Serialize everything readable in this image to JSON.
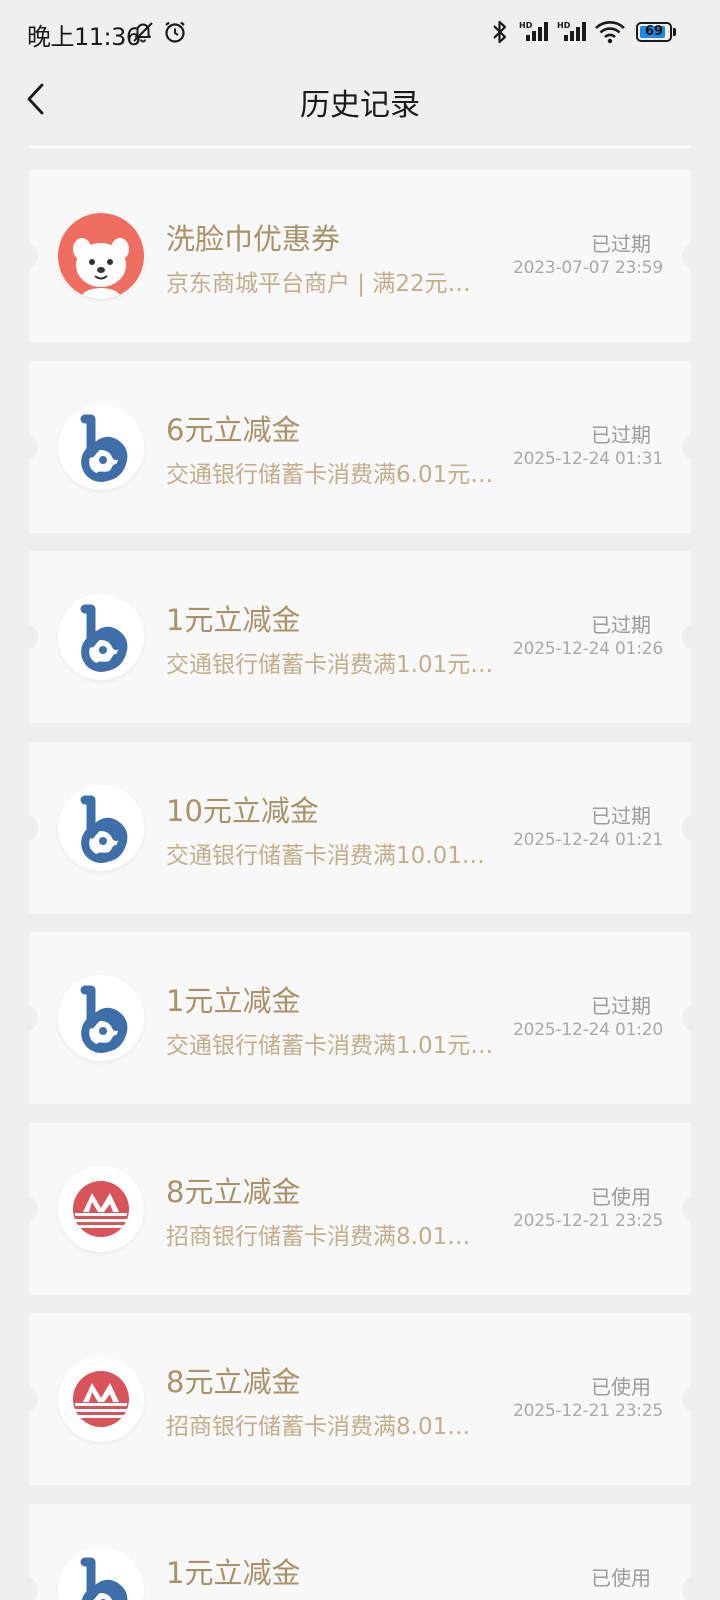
{
  "status_bar": {
    "time": "晚上11:36",
    "icons": [
      "mute-bell-icon",
      "alarm-icon",
      "bluetooth-icon",
      "signal-hd-icon",
      "signal-hd-icon",
      "wifi-icon"
    ],
    "battery": "69",
    "battery_color": "#1e88e5"
  },
  "header": {
    "title": "历史记录",
    "back_icon": "chevron-left-icon"
  },
  "records": [
    {
      "logo": "jd-mascot",
      "title": "洗脸巾优惠券",
      "desc": "京东商城平台商户 | 满22元…",
      "status": "已过期",
      "time": "2023-07-07 23:59"
    },
    {
      "logo": "bocom",
      "title": "6元立减金",
      "desc": "交通银行储蓄卡消费满6.01元…",
      "status": "已过期",
      "time": "2025-12-24 01:31"
    },
    {
      "logo": "bocom",
      "title": "1元立减金",
      "desc": "交通银行储蓄卡消费满1.01元…",
      "status": "已过期",
      "time": "2025-12-24 01:26"
    },
    {
      "logo": "bocom",
      "title": "10元立减金",
      "desc": "交通银行储蓄卡消费满10.01…",
      "status": "已过期",
      "time": "2025-12-24 01:21"
    },
    {
      "logo": "bocom",
      "title": "1元立减金",
      "desc": "交通银行储蓄卡消费满1.01元…",
      "status": "已过期",
      "time": "2025-12-24 01:20"
    },
    {
      "logo": "cmb",
      "title": "8元立减金",
      "desc": "招商银行储蓄卡消费满8.01…",
      "status": "已使用",
      "time": "2025-12-21 23:25"
    },
    {
      "logo": "cmb",
      "title": "8元立减金",
      "desc": "招商银行储蓄卡消费满8.01…",
      "status": "已使用",
      "time": "2025-12-21 23:25"
    },
    {
      "logo": "bocom",
      "title": "1元立减金",
      "desc": "",
      "status": "已使用",
      "time": ""
    }
  ],
  "colors": {
    "background": "#efefef",
    "card": "#f8f8f8",
    "title_gold": "#a9916a",
    "desc_gold": "#c2ae8c",
    "status_gray": "#9c9c9c",
    "bocom_blue": "#3f6fa8",
    "cmb_red": "#d9535a",
    "jd_red": "#ee6e62"
  }
}
